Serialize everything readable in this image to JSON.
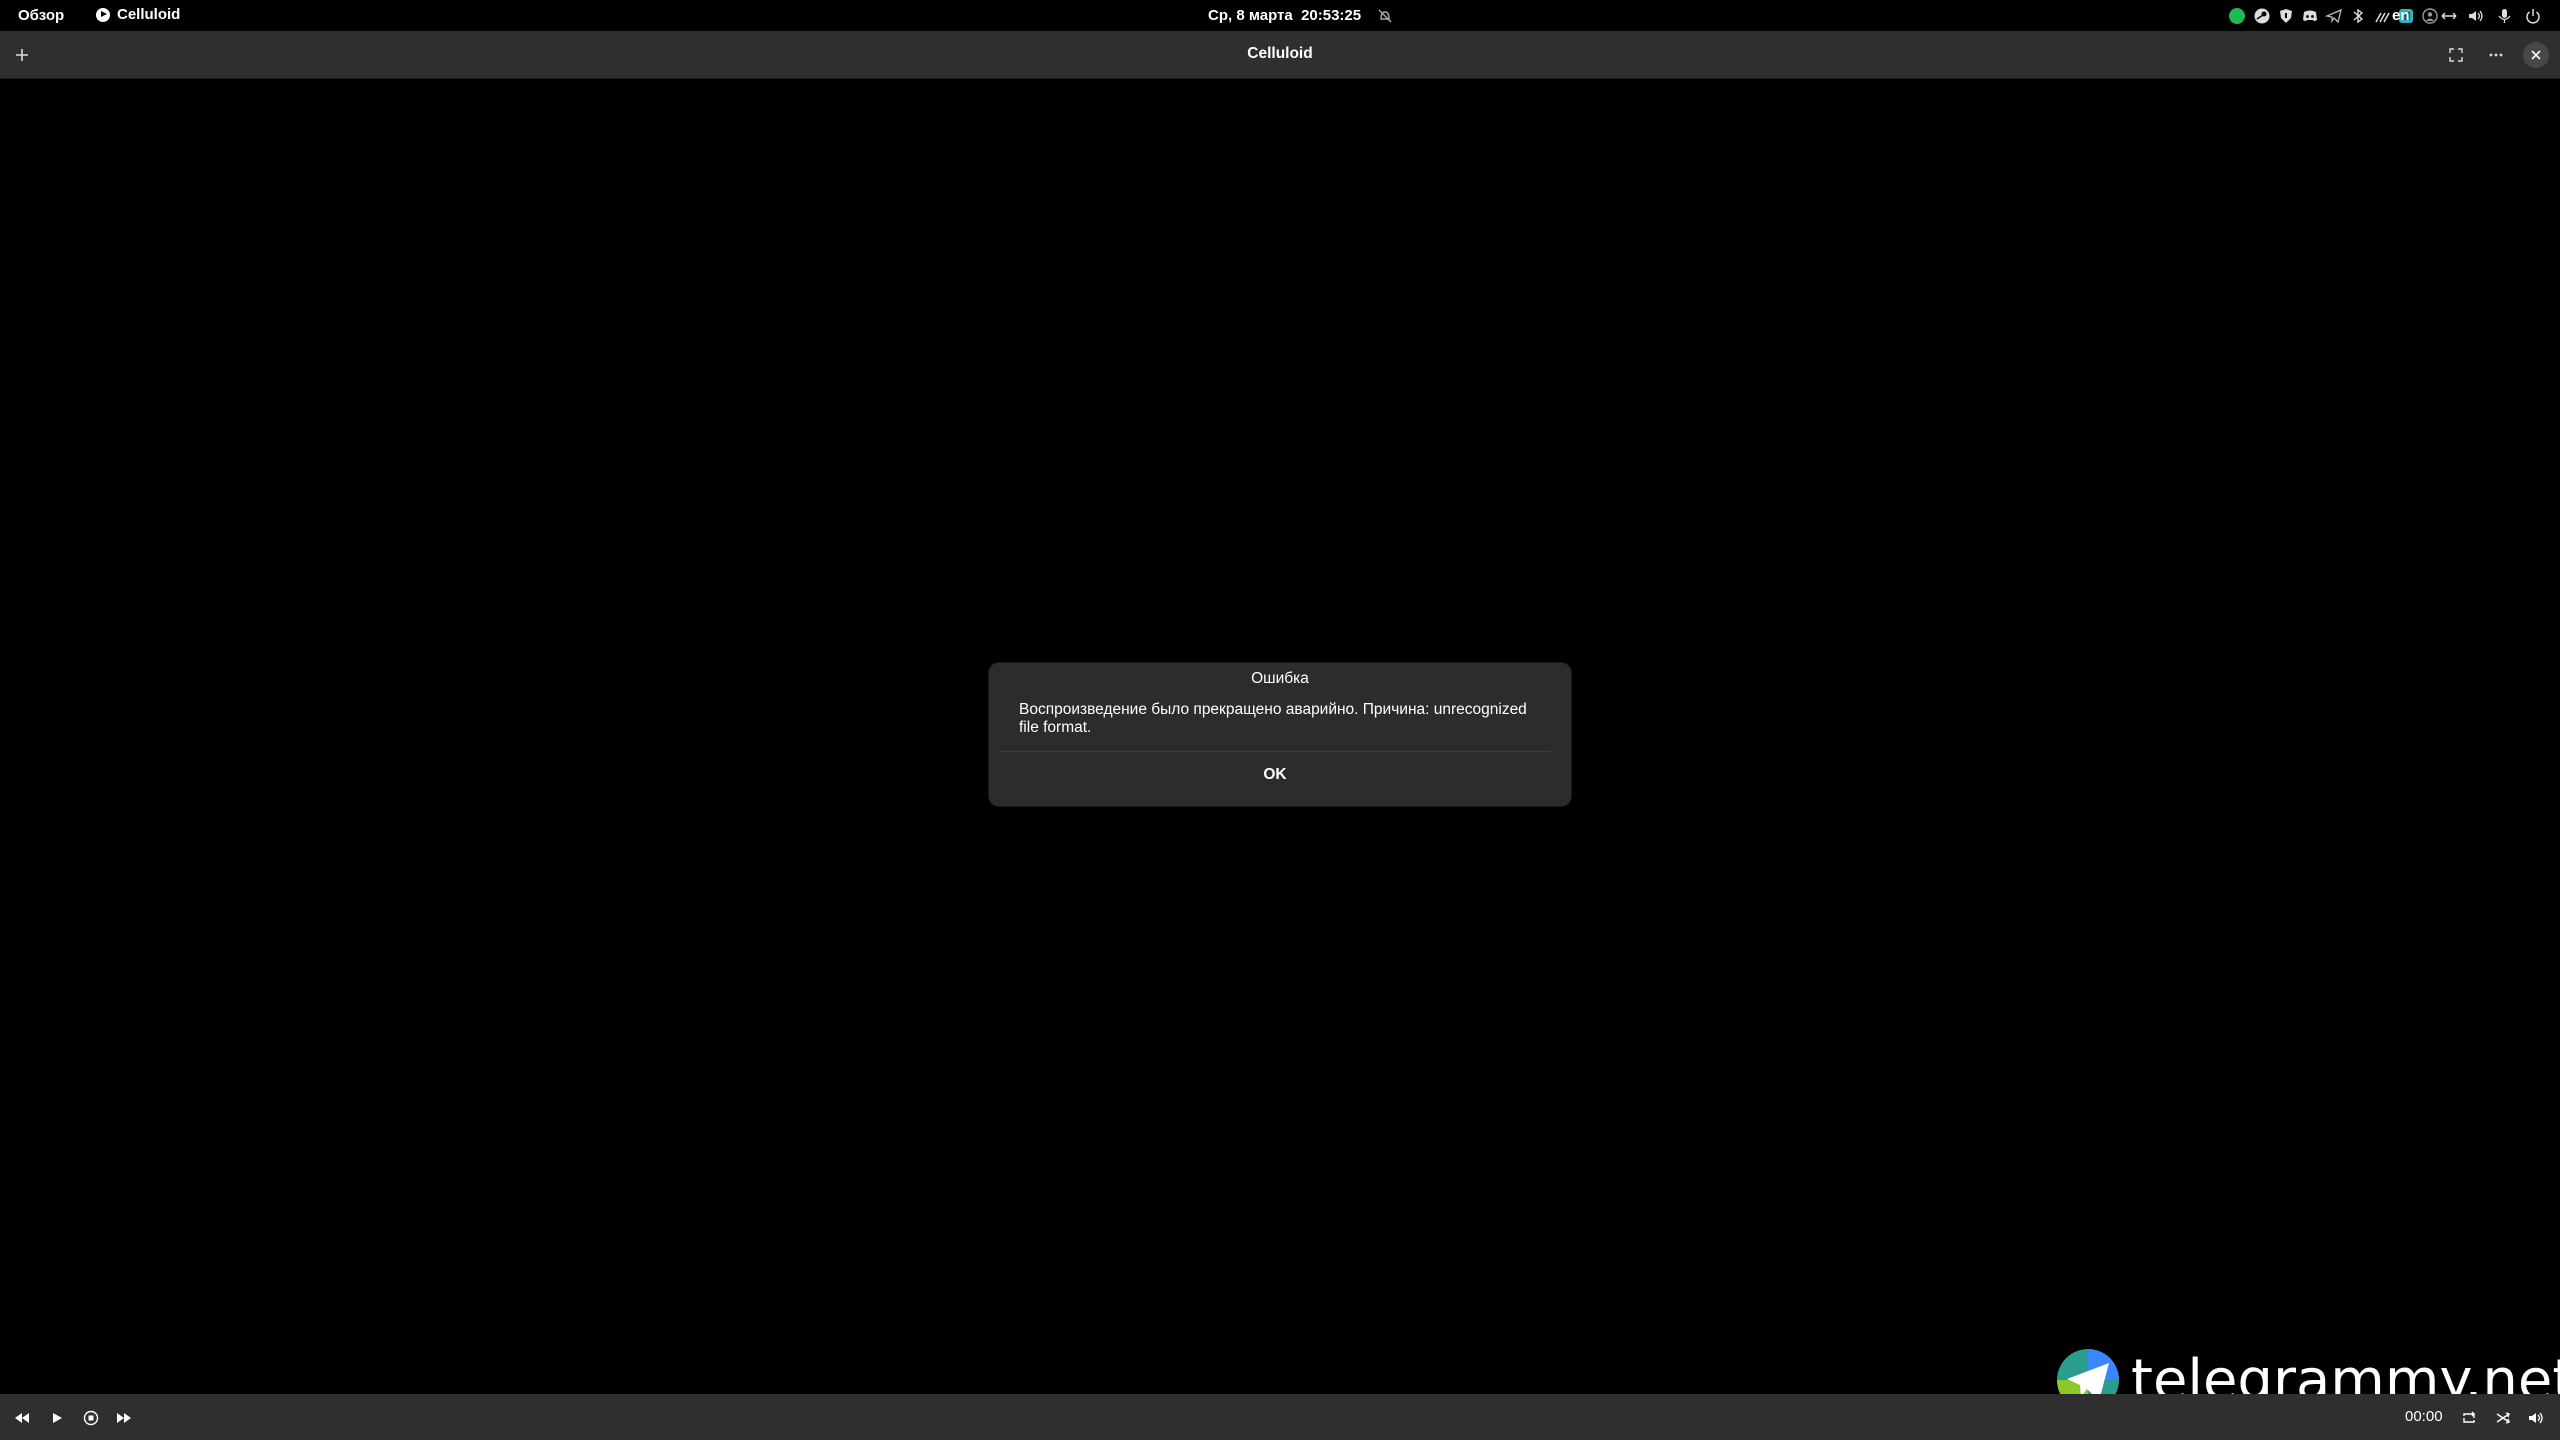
{
  "topbar": {
    "activities_label": "Обзор",
    "app_name": "Celluloid",
    "clock": "Ср, 8 марта  20:53:25",
    "language": "en"
  },
  "window": {
    "title": "Celluloid"
  },
  "dialog": {
    "title": "Ошибка",
    "message": "Воспроизведение было прекращено аварийно. Причина: unrecognized file format.",
    "ok_label": "OK"
  },
  "watermark": {
    "text": "telegrammy.net"
  },
  "controls": {
    "time": "00:00"
  },
  "colors": {
    "background": "#000000",
    "headerbar": "#2f2f2f",
    "dialog": "#2c2c2c",
    "tray_green": "#1db954",
    "tray_teal": "#2bb3c0"
  },
  "icons": {
    "tray": [
      "green-dot-icon",
      "steam-icon",
      "shield-icon",
      "discord-icon",
      "telegram-icon",
      "bluetooth-icon",
      "pen-icon",
      "grid-icon",
      "account-icon",
      "network-icon",
      "volume-icon",
      "microphone-icon",
      "power-icon"
    ],
    "headerbar": [
      "add-icon",
      "fullscreen-icon",
      "menu-icon",
      "close-icon"
    ],
    "controls": [
      "rewind-icon",
      "play-icon",
      "stop-icon",
      "forward-icon",
      "repeat-icon",
      "shuffle-icon",
      "volume-icon"
    ]
  }
}
